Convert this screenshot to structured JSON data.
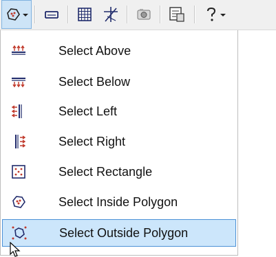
{
  "toolbar": {
    "buttons": [
      {
        "name": "select-polygon-dropdown",
        "icon": "polygon-select-icon",
        "has_dropdown": true
      },
      {
        "name": "align-tool",
        "icon": "align-icon"
      },
      {
        "name": "grid-tool",
        "icon": "grid-icon"
      },
      {
        "name": "snap-tool",
        "icon": "snap-icon"
      },
      {
        "name": "camera-tool",
        "icon": "camera-icon"
      },
      {
        "name": "properties-tool",
        "icon": "properties-icon"
      },
      {
        "name": "help-tool",
        "icon": "help-icon",
        "has_dropdown": true
      }
    ]
  },
  "menu": {
    "items": [
      {
        "label": "Select Above",
        "icon": "select-above-icon"
      },
      {
        "label": "Select Below",
        "icon": "select-below-icon"
      },
      {
        "label": "Select Left",
        "icon": "select-left-icon"
      },
      {
        "label": "Select Right",
        "icon": "select-right-icon"
      },
      {
        "label": "Select Rectangle",
        "icon": "select-rectangle-icon"
      },
      {
        "label": "Select Inside Polygon",
        "icon": "select-inside-polygon-icon"
      },
      {
        "label": "Select Outside Polygon",
        "icon": "select-outside-polygon-icon",
        "highlighted": true
      }
    ]
  },
  "colors": {
    "highlight_bg": "#cce6fb",
    "highlight_border": "#4a90d6",
    "icon_red": "#c0392b",
    "icon_navy": "#1f2a6b"
  }
}
